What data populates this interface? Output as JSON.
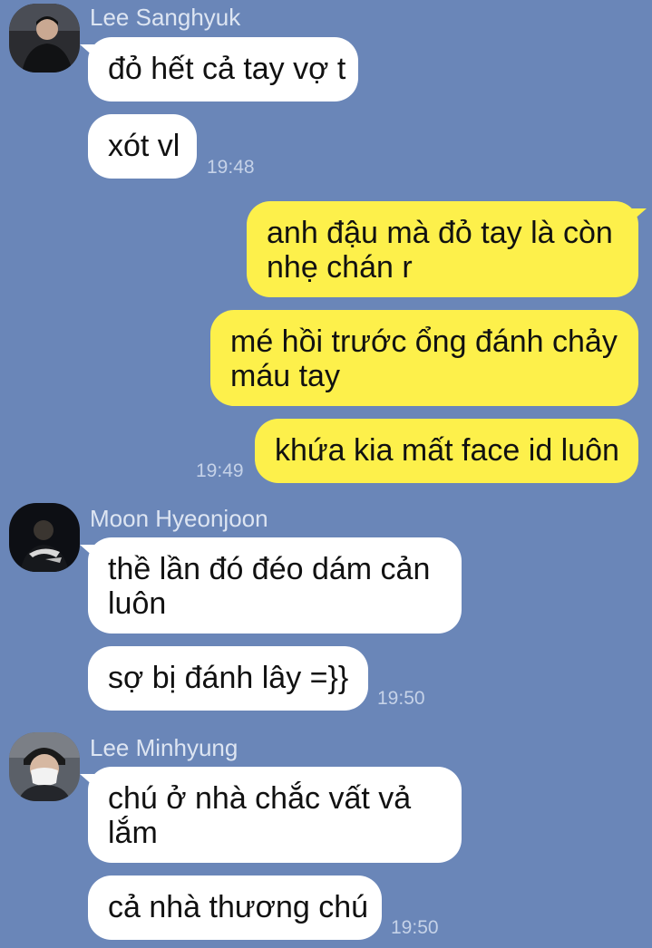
{
  "theme": {
    "background": "#6a86b8",
    "incoming_bubble": "#ffffff",
    "outgoing_bubble": "#fdf04b",
    "text": "#111111",
    "sender_name": "#dde5f2",
    "timestamp": "#c5d2e8"
  },
  "messages": {
    "group1": {
      "sender": "Lee Sanghyuk",
      "avatar_icon": "profile-photo-icon",
      "m1": "đỏ hết cả tay vợ t",
      "m2": "xót vl",
      "time": "19:48"
    },
    "group2": {
      "m1_line1": "anh đậu mà đỏ tay là còn",
      "m1_line2": "nhẹ chán r",
      "m2_line1": "mé hồi trước ổng đánh chảy",
      "m2_line2": "máu tay",
      "m3": "khứa kia mất face id luôn",
      "time": "19:49"
    },
    "group3": {
      "sender": "Moon Hyeonjoon",
      "avatar_icon": "profile-photo-icon",
      "m1_line1": "thề lần đó đéo dám cản",
      "m1_line2": "luôn",
      "m2": "sợ bị đánh lây =}}",
      "time": "19:50"
    },
    "group4": {
      "sender": "Lee Minhyung",
      "avatar_icon": "profile-photo-icon",
      "m1_line1": "chú ở nhà chắc vất vả",
      "m1_line2": "lắm",
      "m2": "cả nhà thương chú",
      "time": "19:50"
    }
  }
}
